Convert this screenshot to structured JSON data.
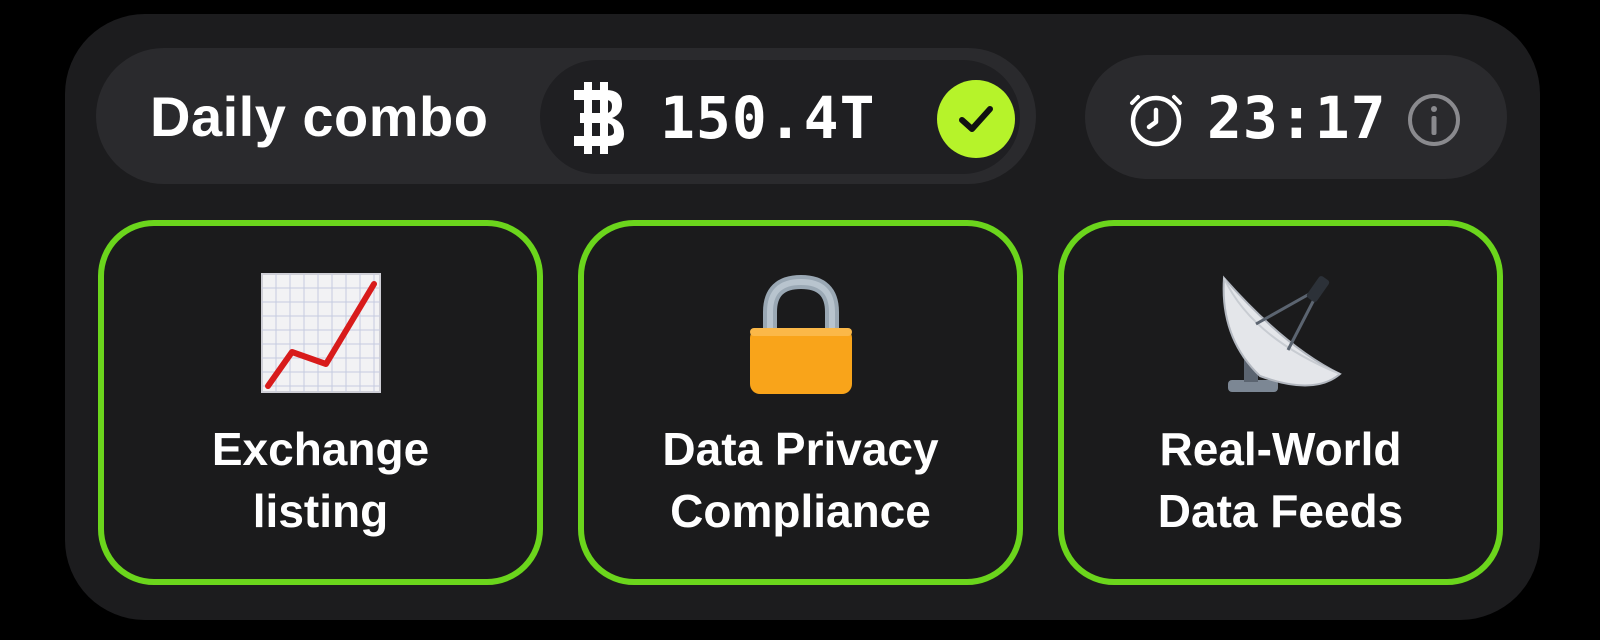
{
  "header": {
    "title": "Daily combo",
    "reward": {
      "icon": "coin-icon",
      "amount": "150.4T",
      "status_icon": "check-icon",
      "accent": "#b6f32a"
    },
    "timer": {
      "icon": "clock-icon",
      "value": "23:17",
      "info_icon": "info-icon"
    }
  },
  "cards": [
    {
      "label": "Exchange\nlisting",
      "icon": "chart-increasing-icon"
    },
    {
      "label": "Data Privacy\nCompliance",
      "icon": "lock-icon"
    },
    {
      "label": "Real-World\nData Feeds",
      "icon": "satellite-antenna-icon"
    }
  ],
  "colors": {
    "background": "#000000",
    "panel": "#1c1c1e",
    "pill": "#2a2a2d",
    "card_border": "#6bd51c"
  }
}
